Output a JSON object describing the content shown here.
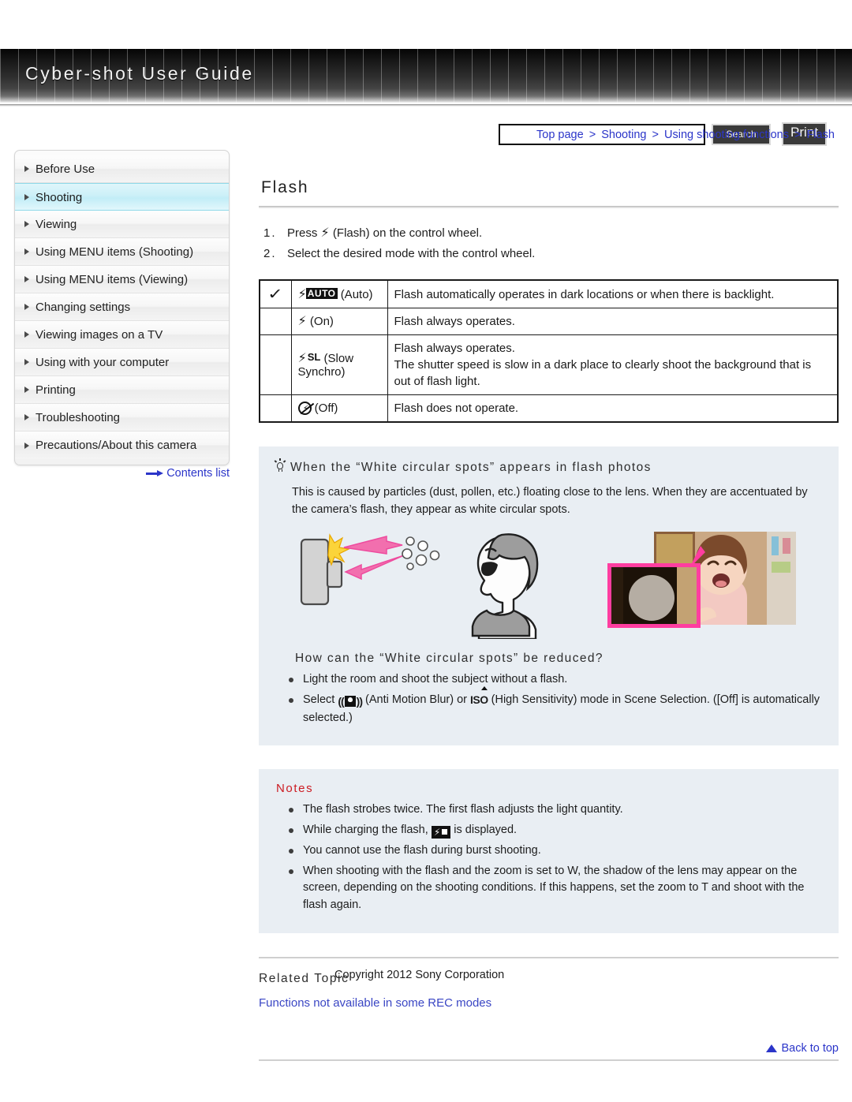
{
  "header": {
    "brand": "Cyber-shot User Guide",
    "search_value": "",
    "search_placeholder": "",
    "search_button": "Search",
    "print_button": "Print"
  },
  "breadcrumb": {
    "items": [
      "Top page",
      "Shooting",
      "Using shooting functions",
      "Flash"
    ],
    "separator": ">"
  },
  "sidebar": {
    "items": [
      {
        "label": "Before Use",
        "active": false
      },
      {
        "label": "Shooting",
        "active": true
      },
      {
        "label": "Viewing",
        "active": false
      },
      {
        "label": "Using MENU items (Shooting)",
        "active": false
      },
      {
        "label": "Using MENU items (Viewing)",
        "active": false
      },
      {
        "label": "Changing settings",
        "active": false
      },
      {
        "label": "Viewing images on a TV",
        "active": false
      },
      {
        "label": "Using with your computer",
        "active": false
      },
      {
        "label": "Printing",
        "active": false
      },
      {
        "label": "Troubleshooting",
        "active": false
      },
      {
        "label": "Precautions/About this camera",
        "active": false
      }
    ],
    "contents_link": "Contents list"
  },
  "main": {
    "title": "Flash",
    "steps": [
      {
        "num": "1.",
        "text_before": "Press",
        "icon": "flash-bolt-icon",
        "text_after": "(Flash) on the control wheel."
      },
      {
        "num": "2.",
        "text_before": "Select the desired mode with the control wheel.",
        "icon": "",
        "text_after": ""
      }
    ],
    "table": {
      "rows": [
        {
          "checked": true,
          "icon": "flash-auto-icon",
          "icon_label": "AUTO",
          "mode": "(Auto)",
          "description": "Flash automatically operates in dark locations or when there is backlight."
        },
        {
          "checked": false,
          "icon": "flash-on-icon",
          "icon_label": "",
          "mode": "(On)",
          "description": "Flash always operates."
        },
        {
          "checked": false,
          "icon": "flash-slow-synchro-icon",
          "icon_label": "SL",
          "mode": "(Slow Synchro)",
          "description": "Flash always operates.\nThe shutter speed is slow in a dark place to clearly shoot the background that is out of flash light."
        },
        {
          "checked": false,
          "icon": "flash-off-icon",
          "icon_label": "",
          "mode": "(Off)",
          "description": "Flash does not operate."
        }
      ]
    },
    "tip_box": {
      "heading": "When the “White circular spots” appears in flash photos",
      "body": "This is caused by particles (dust, pollen, etc.) floating close to the lens. When they are accentuated by the camera’s flash, they appear as white circular spots.",
      "subheading": "How can the “White circular spots” be reduced?",
      "bullets": [
        {
          "text_before": "Light the room and shoot the subject without a flash.",
          "icon1": "",
          "mid": "",
          "icon2": "",
          "text_after": ""
        },
        {
          "text_before": "Select",
          "icon1": "anti-motion-blur-icon",
          "mid": "(Anti Motion Blur) or",
          "icon2": "high-sensitivity-iso-icon",
          "text_after": "(High Sensitivity) mode in Scene Selection. ([Off] is automatically selected.)"
        }
      ]
    },
    "notes_box": {
      "title": "Notes",
      "items": [
        {
          "before": "The flash strobes twice. The first flash adjusts the light quantity.",
          "icon": "",
          "after": ""
        },
        {
          "before": "While charging the flash,",
          "icon": "flash-charging-icon",
          "after": "is displayed."
        },
        {
          "before": "You cannot use the flash during burst shooting.",
          "icon": "",
          "after": ""
        },
        {
          "before": "When shooting with the flash and the zoom is set to W, the shadow of the lens may appear on the screen, depending on the shooting conditions. If this happens, set the zoom to T and shoot with the flash again.",
          "icon": "",
          "after": ""
        }
      ]
    },
    "related": {
      "title": "Related Topic",
      "link": "Functions not available in some REC modes"
    },
    "back_to_top": "Back to top"
  },
  "footer": {
    "copyright": "Copyright 2012 Sony Corporation"
  },
  "colors": {
    "link": "#2b35c9",
    "notes_red": "#cc1b22",
    "box_bg": "#e9eef3",
    "sidebar_active": "#c2edf7",
    "header_dark": "#141414"
  }
}
